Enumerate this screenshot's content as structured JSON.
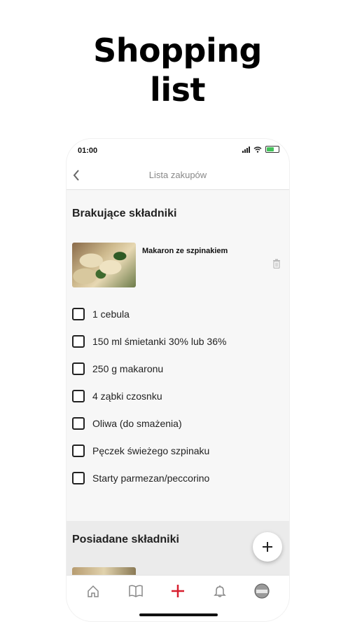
{
  "headline": {
    "line1": "Shopping",
    "line2": "list"
  },
  "status_bar": {
    "time": "01:00"
  },
  "navbar": {
    "back_icon": "chevron-left-icon",
    "title": "Lista zakupów"
  },
  "missing": {
    "title": "Brakujące składniki",
    "recipe": {
      "name": "Makaron ze szpinakiem"
    },
    "items": [
      {
        "label": "1 cebula",
        "checked": false
      },
      {
        "label": "150 ml śmietanki 30% lub 36%",
        "checked": false
      },
      {
        "label": "250 g makaronu",
        "checked": false
      },
      {
        "label": "4 ząbki czosnku",
        "checked": false
      },
      {
        "label": "Oliwa (do smażenia)",
        "checked": false
      },
      {
        "label": "Pęczek świeżego szpinaku",
        "checked": false
      },
      {
        "label": "Starty parmezan/peccorino",
        "checked": false
      }
    ]
  },
  "owned": {
    "title": "Posiadane składniki"
  },
  "tabbar": {
    "tabs": [
      "home-icon",
      "book-icon",
      "add-icon",
      "bell-icon",
      "profile-avatar"
    ],
    "accent": "#d71f2f"
  }
}
